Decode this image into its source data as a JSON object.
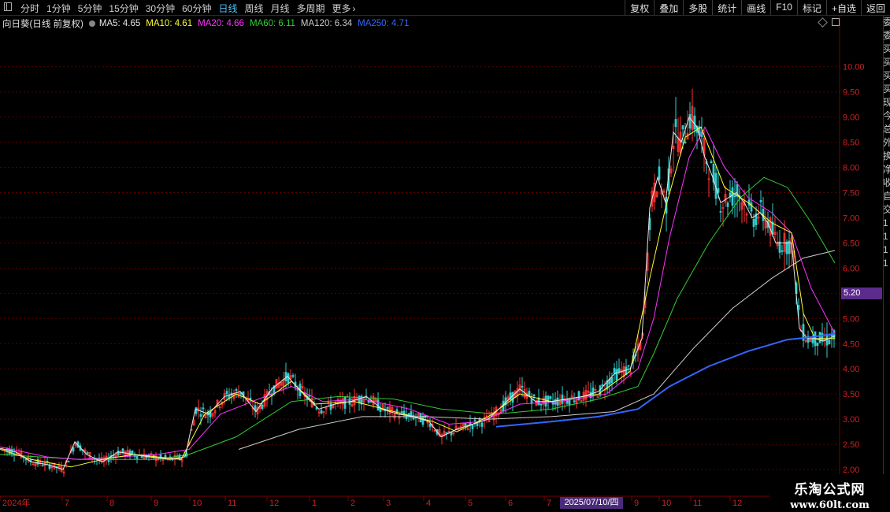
{
  "toolbar": {
    "periods": [
      "分时",
      "1分钟",
      "5分钟",
      "15分钟",
      "30分钟",
      "60分钟",
      "日线",
      "周线",
      "月线",
      "多周期",
      "更多"
    ],
    "active_period": "日线",
    "tools": [
      "复权",
      "叠加",
      "多股",
      "统计",
      "画线",
      "F10",
      "标记",
      "+自选",
      "返回"
    ]
  },
  "legend": {
    "title": "向日葵(日线 前复权)",
    "ma5": "MA5: 4.65",
    "ma10": "MA10: 4.61",
    "ma20": "MA20: 4.66",
    "ma60": "MA60: 6.11",
    "ma120": "MA120: 6.34",
    "ma250": "MA250: 4.71"
  },
  "price_axis": {
    "ticks": [
      "10.00",
      "9.50",
      "9.00",
      "8.50",
      "8.00",
      "7.50",
      "7.00",
      "6.50",
      "6.00",
      "5.50",
      "5.00",
      "4.50",
      "4.00",
      "3.50",
      "3.00",
      "2.50",
      "2.00"
    ],
    "current_price_tag": "5.20"
  },
  "date_axis": {
    "labels": [
      "2024年",
      "7",
      "8",
      "9",
      "10",
      "11",
      "12",
      "1",
      "2",
      "3",
      "4",
      "5",
      "6",
      "7",
      "9",
      "10",
      "11",
      "12"
    ],
    "cursor_date": "2025/07/10/四"
  },
  "side_panel_chars": [
    "委",
    "委",
    "买",
    "买",
    "买",
    "买",
    "现",
    "今",
    "总",
    "外",
    "换",
    "净",
    "收",
    "自",
    "交",
    "1",
    "1",
    "1",
    "1"
  ],
  "watermark": {
    "line1": "乐淘公式网",
    "line2": "www.60lt.com"
  },
  "colors": {
    "up": "#ff3333",
    "down": "#33cccc",
    "ma5": "#e6e6e6",
    "ma10": "#ffff33",
    "ma20": "#ff33ff",
    "ma60": "#33cc33",
    "ma120": "#cccccc",
    "ma250": "#3366ff",
    "grid": "#5a0000"
  },
  "chart_data": {
    "type": "candlestick",
    "ylim": [
      1.5,
      10.7
    ],
    "ma_series": [
      {
        "name": "MA5",
        "key": "ma5"
      },
      {
        "name": "MA10",
        "key": "ma10"
      },
      {
        "name": "MA20",
        "key": "ma20"
      },
      {
        "name": "MA60",
        "key": "ma60"
      },
      {
        "name": "MA120",
        "key": "ma120"
      },
      {
        "name": "MA250",
        "key": "ma250"
      }
    ],
    "close_path": [
      [
        0,
        2.42
      ],
      [
        20,
        2.35
      ],
      [
        40,
        2.15
      ],
      [
        60,
        2.1
      ],
      [
        80,
        2.0
      ],
      [
        95,
        2.55
      ],
      [
        110,
        2.3
      ],
      [
        130,
        2.15
      ],
      [
        150,
        2.35
      ],
      [
        170,
        2.3
      ],
      [
        190,
        2.25
      ],
      [
        215,
        2.2
      ],
      [
        235,
        2.25
      ],
      [
        248,
        3.2
      ],
      [
        265,
        3.1
      ],
      [
        285,
        3.45
      ],
      [
        305,
        3.55
      ],
      [
        325,
        3.15
      ],
      [
        345,
        3.6
      ],
      [
        365,
        3.85
      ],
      [
        385,
        3.5
      ],
      [
        405,
        3.2
      ],
      [
        425,
        3.3
      ],
      [
        445,
        3.35
      ],
      [
        465,
        3.45
      ],
      [
        485,
        3.2
      ],
      [
        505,
        3.1
      ],
      [
        525,
        3.05
      ],
      [
        545,
        2.95
      ],
      [
        560,
        2.65
      ],
      [
        580,
        2.8
      ],
      [
        600,
        2.9
      ],
      [
        620,
        3.0
      ],
      [
        640,
        3.3
      ],
      [
        660,
        3.6
      ],
      [
        680,
        3.35
      ],
      [
        700,
        3.35
      ],
      [
        720,
        3.4
      ],
      [
        740,
        3.45
      ],
      [
        760,
        3.55
      ],
      [
        780,
        3.9
      ],
      [
        800,
        4.0
      ],
      [
        815,
        4.6
      ],
      [
        825,
        7.2
      ],
      [
        835,
        7.8
      ],
      [
        845,
        7.3
      ],
      [
        855,
        8.7
      ],
      [
        865,
        8.5
      ],
      [
        875,
        9.0
      ],
      [
        885,
        8.8
      ],
      [
        895,
        8.2
      ],
      [
        905,
        7.8
      ],
      [
        915,
        7.3
      ],
      [
        925,
        7.4
      ],
      [
        935,
        7.5
      ],
      [
        945,
        7.3
      ],
      [
        955,
        7.0
      ],
      [
        965,
        7.1
      ],
      [
        975,
        6.9
      ],
      [
        985,
        6.5
      ],
      [
        995,
        6.5
      ],
      [
        1005,
        6.5
      ],
      [
        1015,
        4.8
      ],
      [
        1025,
        4.6
      ],
      [
        1035,
        4.6
      ],
      [
        1045,
        4.55
      ],
      [
        1060,
        4.65
      ]
    ],
    "ma_paths": {
      "ma10": [
        [
          0,
          2.4
        ],
        [
          40,
          2.2
        ],
        [
          90,
          2.05
        ],
        [
          130,
          2.2
        ],
        [
          170,
          2.3
        ],
        [
          230,
          2.2
        ],
        [
          260,
          3.1
        ],
        [
          300,
          3.5
        ],
        [
          330,
          3.3
        ],
        [
          370,
          3.75
        ],
        [
          400,
          3.3
        ],
        [
          450,
          3.35
        ],
        [
          500,
          3.15
        ],
        [
          550,
          2.95
        ],
        [
          580,
          2.75
        ],
        [
          620,
          3.05
        ],
        [
          660,
          3.5
        ],
        [
          700,
          3.35
        ],
        [
          760,
          3.5
        ],
        [
          800,
          3.95
        ],
        [
          825,
          5.8
        ],
        [
          845,
          7.2
        ],
        [
          870,
          8.6
        ],
        [
          890,
          8.8
        ],
        [
          920,
          7.6
        ],
        [
          950,
          7.3
        ],
        [
          980,
          6.9
        ],
        [
          1005,
          6.7
        ],
        [
          1020,
          5.1
        ],
        [
          1035,
          4.6
        ],
        [
          1060,
          4.6
        ]
      ],
      "ma20": [
        [
          0,
          2.45
        ],
        [
          60,
          2.25
        ],
        [
          100,
          2.2
        ],
        [
          150,
          2.25
        ],
        [
          200,
          2.3
        ],
        [
          240,
          2.4
        ],
        [
          280,
          3.1
        ],
        [
          320,
          3.35
        ],
        [
          370,
          3.65
        ],
        [
          410,
          3.35
        ],
        [
          460,
          3.4
        ],
        [
          520,
          3.2
        ],
        [
          570,
          2.9
        ],
        [
          610,
          2.95
        ],
        [
          660,
          3.3
        ],
        [
          710,
          3.35
        ],
        [
          770,
          3.5
        ],
        [
          810,
          4.0
        ],
        [
          830,
          5.0
        ],
        [
          850,
          6.6
        ],
        [
          875,
          8.2
        ],
        [
          895,
          8.8
        ],
        [
          920,
          8.0
        ],
        [
          950,
          7.4
        ],
        [
          980,
          7.1
        ],
        [
          1005,
          6.7
        ],
        [
          1030,
          5.6
        ],
        [
          1060,
          4.7
        ]
      ],
      "ma60": [
        [
          0,
          2.3
        ],
        [
          100,
          2.2
        ],
        [
          200,
          2.2
        ],
        [
          240,
          2.3
        ],
        [
          300,
          2.65
        ],
        [
          370,
          3.35
        ],
        [
          430,
          3.45
        ],
        [
          500,
          3.4
        ],
        [
          560,
          3.2
        ],
        [
          630,
          3.1
        ],
        [
          700,
          3.2
        ],
        [
          760,
          3.4
        ],
        [
          810,
          3.65
        ],
        [
          830,
          4.3
        ],
        [
          860,
          5.4
        ],
        [
          900,
          6.5
        ],
        [
          940,
          7.4
        ],
        [
          970,
          7.8
        ],
        [
          1000,
          7.6
        ],
        [
          1030,
          6.9
        ],
        [
          1060,
          6.1
        ]
      ],
      "ma120": [
        [
          303,
          2.4
        ],
        [
          380,
          2.8
        ],
        [
          460,
          3.05
        ],
        [
          540,
          3.05
        ],
        [
          620,
          3.0
        ],
        [
          700,
          3.05
        ],
        [
          780,
          3.15
        ],
        [
          830,
          3.5
        ],
        [
          880,
          4.4
        ],
        [
          930,
          5.2
        ],
        [
          980,
          5.8
        ],
        [
          1020,
          6.2
        ],
        [
          1060,
          6.35
        ]
      ],
      "ma250": [
        [
          630,
          2.85
        ],
        [
          700,
          2.95
        ],
        [
          760,
          3.05
        ],
        [
          810,
          3.2
        ],
        [
          850,
          3.65
        ],
        [
          900,
          4.05
        ],
        [
          950,
          4.35
        ],
        [
          1000,
          4.58
        ],
        [
          1030,
          4.63
        ],
        [
          1060,
          4.7
        ]
      ]
    }
  }
}
